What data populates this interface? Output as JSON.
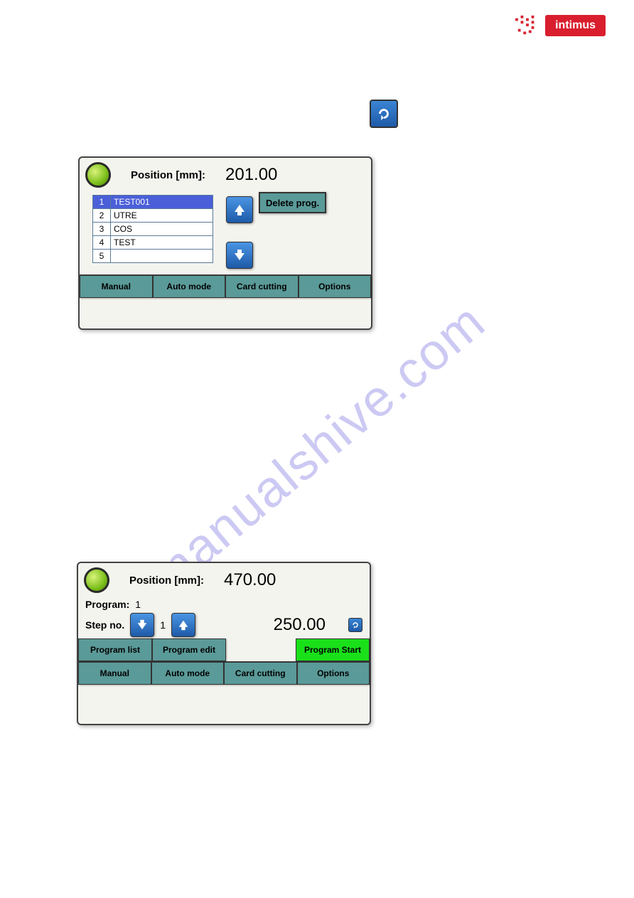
{
  "brand": "intimus",
  "watermark": "manualshive.com",
  "panel1": {
    "position_label": "Position  [mm]:",
    "position_value": "201.00",
    "programs": [
      {
        "n": "1",
        "name": "TEST001",
        "selected": true
      },
      {
        "n": "2",
        "name": "UTRE"
      },
      {
        "n": "3",
        "name": "COS"
      },
      {
        "n": "4",
        "name": "TEST"
      },
      {
        "n": "5",
        "name": ""
      }
    ],
    "delete_label": "Delete prog.",
    "bottom": [
      "Manual",
      "Auto mode",
      "Card cutting",
      "Options"
    ]
  },
  "panel2": {
    "position_label": "Position  [mm]:",
    "position_value": "470.00",
    "program_label": "Program:",
    "program_value": "1",
    "step_label": "Step no.",
    "step_value": "1",
    "target_value": "250.00",
    "actions": {
      "program_list": "Program list",
      "program_edit": "Program edit",
      "program_start": "Program Start"
    },
    "bottom": [
      "Manual",
      "Auto mode",
      "Card cutting",
      "Options"
    ]
  }
}
